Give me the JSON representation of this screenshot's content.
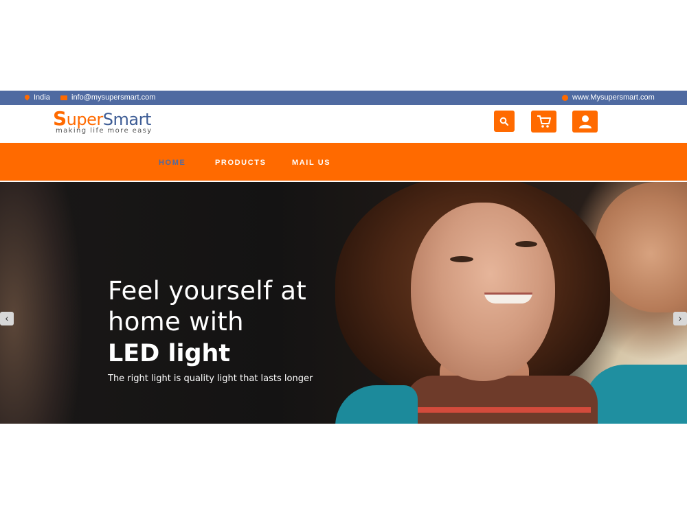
{
  "topbar": {
    "country": "India",
    "email": "info@mysupersmart.com",
    "website": "www.Mysupersmart.com",
    "icons": {
      "country": "map-pin-icon",
      "email": "envelope-icon",
      "website": "globe-icon"
    }
  },
  "header": {
    "logo": {
      "initial": "S",
      "part1": "uper",
      "part2": "Smart",
      "tagline": "making life more easy"
    },
    "buttons": [
      {
        "icon": "search-icon"
      },
      {
        "icon": "cart-icon"
      },
      {
        "icon": "user-icon"
      }
    ]
  },
  "nav": {
    "items": [
      {
        "label": "HOME",
        "active": true
      },
      {
        "label": "PRODUCTS",
        "active": false
      },
      {
        "label": "MAIL US",
        "active": false
      }
    ]
  },
  "hero": {
    "line1": "Feel yourself at",
    "line2": "home with",
    "line3": "LED light",
    "subtitle": "The right light is quality light that lasts longer",
    "prev": "‹",
    "next": "›"
  },
  "colors": {
    "topbar": "#4f6aa1",
    "accent": "#ff6a00",
    "nav_active": "#4f6aa1"
  }
}
